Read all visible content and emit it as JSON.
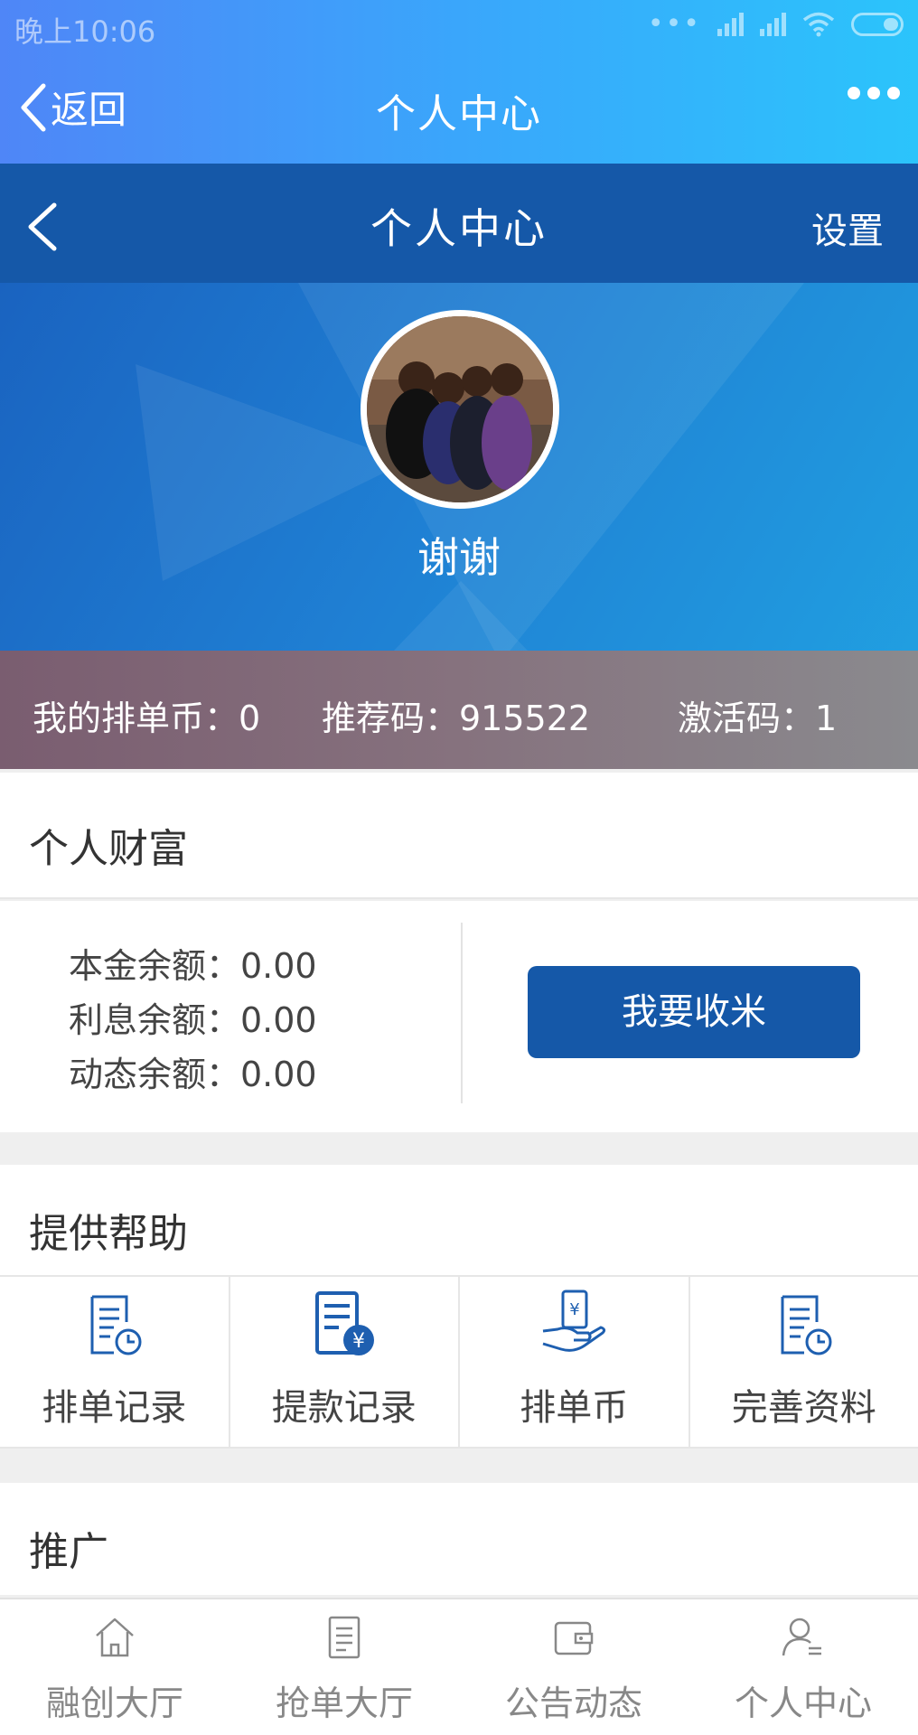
{
  "status_bar": {
    "time": "晚上10:06"
  },
  "webview_bar": {
    "back_label": "返回",
    "title": "个人中心"
  },
  "app_header": {
    "title": "个人中心",
    "settings_label": "设置"
  },
  "profile": {
    "username": "谢谢",
    "stats": {
      "paidan_coin": "我的排单币：0",
      "referral_code": "推荐码：915522",
      "activation_code": "激活码：1"
    }
  },
  "wealth": {
    "title": "个人财富",
    "principal": "本金余额：0.00",
    "interest": "利息余额：0.00",
    "dynamic": "动态余额：0.00",
    "collect_button": "我要收米"
  },
  "help": {
    "title": "提供帮助",
    "items": [
      {
        "label": "排单记录",
        "icon": "document-clock-icon"
      },
      {
        "label": "提款记录",
        "icon": "document-yuan-icon"
      },
      {
        "label": "排单币",
        "icon": "hand-yuan-icon"
      },
      {
        "label": "完善资料",
        "icon": "document-clock-icon"
      }
    ]
  },
  "promotion": {
    "title": "推广"
  },
  "bottom_nav": {
    "items": [
      {
        "label": "融创大厅",
        "icon": "home-icon"
      },
      {
        "label": "抢单大厅",
        "icon": "list-icon"
      },
      {
        "label": "公告动态",
        "icon": "wallet-icon"
      },
      {
        "label": "个人中心",
        "icon": "user-icon"
      }
    ]
  },
  "colors": {
    "primary": "#1558a8",
    "icon_blue": "#1e5fb0",
    "header_gradient_start": "#4f86f7",
    "header_gradient_end": "#2bc4fb"
  }
}
